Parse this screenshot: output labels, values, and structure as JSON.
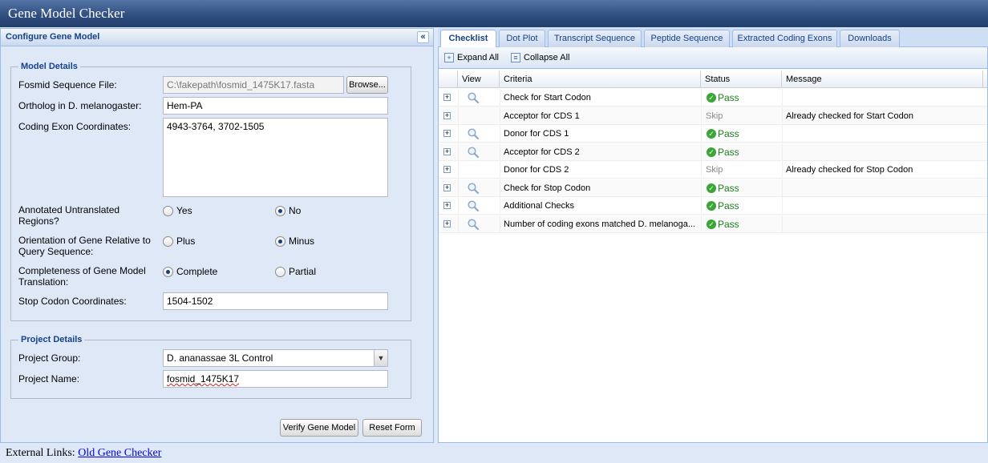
{
  "app": {
    "title": "Gene Model Checker"
  },
  "left": {
    "header": "Configure Gene Model",
    "collapse_icon": "«",
    "model_details": {
      "legend": "Model Details",
      "fosmid_label": "Fosmid Sequence File:",
      "fosmid_value": "C:\\fakepath\\fosmid_1475K17.fasta",
      "browse_label": "Browse...",
      "ortholog_label": "Ortholog in D. melanogaster:",
      "ortholog_value": "Hem-PA",
      "coding_exon_label": "Coding Exon Coordinates:",
      "coding_exon_value": "4943-3764, 3702-1505",
      "utr_label": "Annotated Untranslated Regions?",
      "utr_options": [
        "Yes",
        "No"
      ],
      "utr_selected": "No",
      "orientation_label": "Orientation of Gene Relative to Query Sequence:",
      "orientation_options": [
        "Plus",
        "Minus"
      ],
      "orientation_selected": "Minus",
      "completeness_label": "Completeness of Gene Model Translation:",
      "completeness_options": [
        "Complete",
        "Partial"
      ],
      "completeness_selected": "Complete",
      "stop_codon_label": "Stop Codon Coordinates:",
      "stop_codon_value": "1504-1502"
    },
    "project_details": {
      "legend": "Project Details",
      "group_label": "Project Group:",
      "group_value": "D. ananassae 3L Control",
      "name_label": "Project Name:",
      "name_value": "fosmid_1475K17"
    },
    "verify_label": "Verify Gene Model",
    "reset_label": "Reset Form"
  },
  "footer": {
    "label": "External Links:",
    "link": "Old Gene Checker"
  },
  "tabs": [
    "Checklist",
    "Dot Plot",
    "Transcript Sequence",
    "Peptide Sequence",
    "Extracted Coding Exons",
    "Downloads"
  ],
  "active_tab": "Checklist",
  "toolbar": {
    "expand_all": "Expand All",
    "collapse_all": "Collapse All"
  },
  "grid": {
    "columns": [
      "View",
      "Criteria",
      "Status",
      "Message"
    ],
    "rows": [
      {
        "view": true,
        "criteria": "Check for Start Codon",
        "status": "Pass",
        "message": ""
      },
      {
        "view": false,
        "criteria": "Acceptor for CDS 1",
        "status": "Skip",
        "message": "Already checked for Start Codon"
      },
      {
        "view": true,
        "criteria": "Donor for CDS 1",
        "status": "Pass",
        "message": ""
      },
      {
        "view": true,
        "criteria": "Acceptor for CDS 2",
        "status": "Pass",
        "message": ""
      },
      {
        "view": false,
        "criteria": "Donor for CDS 2",
        "status": "Skip",
        "message": "Already checked for Stop Codon"
      },
      {
        "view": true,
        "criteria": "Check for Stop Codon",
        "status": "Pass",
        "message": ""
      },
      {
        "view": true,
        "criteria": "Additional Checks",
        "status": "Pass",
        "message": ""
      },
      {
        "view": true,
        "criteria": "Number of coding exons matched D. melanoga...",
        "status": "Pass",
        "message": ""
      }
    ]
  },
  "colors": {
    "pass": "#1d7d1a",
    "header_text": "#15428b",
    "title_bar": "#2e4d7f"
  }
}
